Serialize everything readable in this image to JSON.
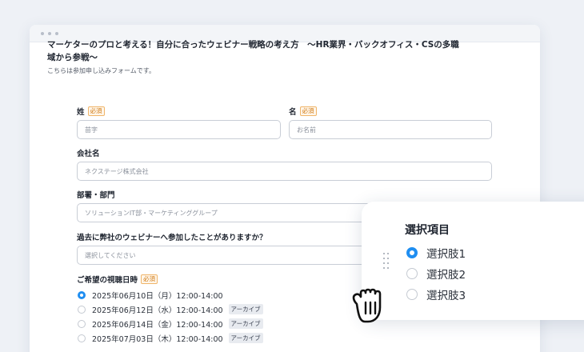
{
  "form": {
    "title": "マーケターのプロと考える！自分に合ったウェビナー戦略の考え方　〜HR業界・バックオフィス・CSの多職域から参戦〜",
    "description": "こちらは参加申し込みフォームです。",
    "required_badge": "必須",
    "last_name_label": "姓",
    "last_name_placeholder": "苗字",
    "first_name_label": "名",
    "first_name_placeholder": "お名前",
    "company_label": "会社名",
    "company_placeholder": "ネクステージ株式会社",
    "department_label": "部署・部門",
    "department_placeholder": "ソリューションIT部・マーケティンググループ",
    "question_label": "過去に弊社のウェビナーへ参加したことがありますか？",
    "question_placeholder": "選択してください",
    "schedule_label": "ご希望の視聴日時",
    "schedule_options": [
      {
        "label": "2025年06月10日（月）12:00-14:00",
        "selected": true,
        "tag": ""
      },
      {
        "label": "2025年06月12日（水）12:00-14:00",
        "selected": false,
        "tag": "アーカイブ"
      },
      {
        "label": "2025年06月14日（金）12:00-14:00",
        "selected": false,
        "tag": "アーカイブ"
      },
      {
        "label": "2025年07月03日（木）12:00-14:00",
        "selected": false,
        "tag": "アーカイブ"
      }
    ]
  },
  "popup": {
    "title": "選択項目",
    "options": [
      {
        "label": "選択肢1",
        "selected": true
      },
      {
        "label": "選択肢2",
        "selected": false
      },
      {
        "label": "選択肢3",
        "selected": false
      }
    ]
  },
  "colors": {
    "accent": "#1f8ef1",
    "badge": "#d07a14",
    "background": "#eef1f6"
  },
  "icons": {
    "drag": "drag-handle-icon",
    "cursor": "grab-hand-icon"
  }
}
